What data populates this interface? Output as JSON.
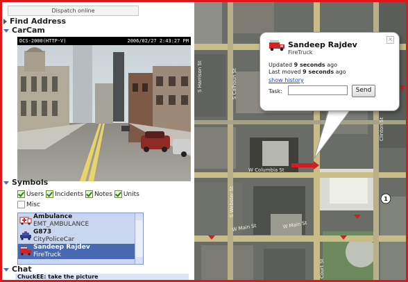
{
  "sidebar": {
    "dispatch_label": "Dispatch online",
    "find_address": "Find Address",
    "carcam": "CarCam",
    "symbols": "Symbols",
    "chat": "Chat"
  },
  "camera": {
    "device": "DCS-2000(HTTP-V)",
    "timestamp": "2006/02/27  2:43:27 PM"
  },
  "filters": {
    "users": "Users",
    "incidents": "Incidents",
    "notes": "Notes",
    "units": "Units",
    "misc": "Misc"
  },
  "units_list": [
    {
      "name": "Ambulance",
      "type": "EMT_AMBULANCE",
      "icon": "ambulance-icon"
    },
    {
      "name": "G873",
      "type": "CityPoliceCar",
      "icon": "police-car-icon"
    },
    {
      "name": "Sandeep Rajdev",
      "type": "FireTruck",
      "icon": "fire-truck-icon",
      "selected": true
    }
  ],
  "chat_line": "ChuckEE: take the picture",
  "popup": {
    "name": "Sandeep Rajdev",
    "type": "FireTruck",
    "updated_prefix": "Updated ",
    "updated_value": "9 seconds",
    "updated_suffix": " ago",
    "moved_prefix": "Last moved ",
    "moved_value": "9 seconds",
    "moved_suffix": " ago",
    "history_link": "show history",
    "task_label": "Task:",
    "task_value": "",
    "send_label": "Send"
  },
  "map": {
    "streets": [
      "W Columbia St",
      "W Main St",
      "W Main St",
      "Court St",
      "S Harrison St",
      "S Webster St",
      "S Calhoun St",
      "Clinton St"
    ],
    "route_badge": "1"
  },
  "colors": {
    "frame_red": "#e0161b",
    "selection_blue": "#4968b2",
    "list_blue": "#c9d6ef",
    "link_blue": "#2344c4"
  }
}
